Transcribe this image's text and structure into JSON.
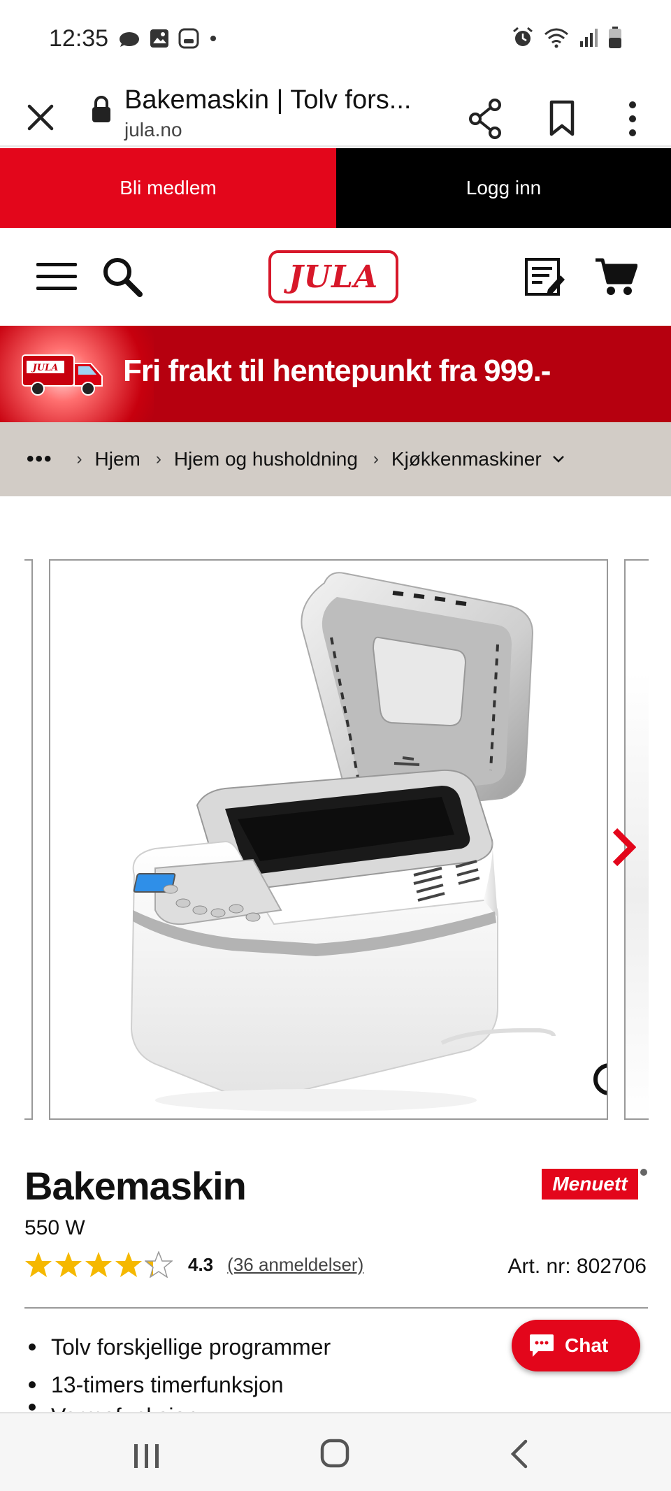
{
  "status_bar": {
    "time": "12:35"
  },
  "browser": {
    "page_title": "Bakemaskin | Tolv fors...",
    "url": "jula.no"
  },
  "member_bar": {
    "join_label": "Bli medlem",
    "login_label": "Logg inn"
  },
  "header": {
    "logo_text": "JULA",
    "truck_logo_text": "JULA"
  },
  "banner": {
    "text": "Fri frakt til hentepunkt fra 999.-"
  },
  "breadcrumb": {
    "more": "•••",
    "items": [
      "Hjem",
      "Hjem og husholdning",
      "Kjøkkenmaskiner"
    ]
  },
  "product": {
    "name": "Bakemaskin",
    "brand": "Menuett",
    "power": "550 W",
    "rating": 4.3,
    "rating_label": "4.3",
    "reviews_label": "(36 anmeldelser)",
    "art_nr_label": "Art. nr: 802706",
    "features": [
      "Tolv forskjellige programmer",
      "13-timers timerfunksjon",
      "Varmefunksjon"
    ]
  },
  "chat": {
    "label": "Chat"
  },
  "colors": {
    "accent": "#e3061b",
    "banner": "#b6000f",
    "breadcrumb_bg": "#d2ccc6",
    "star": "#f5b800"
  }
}
